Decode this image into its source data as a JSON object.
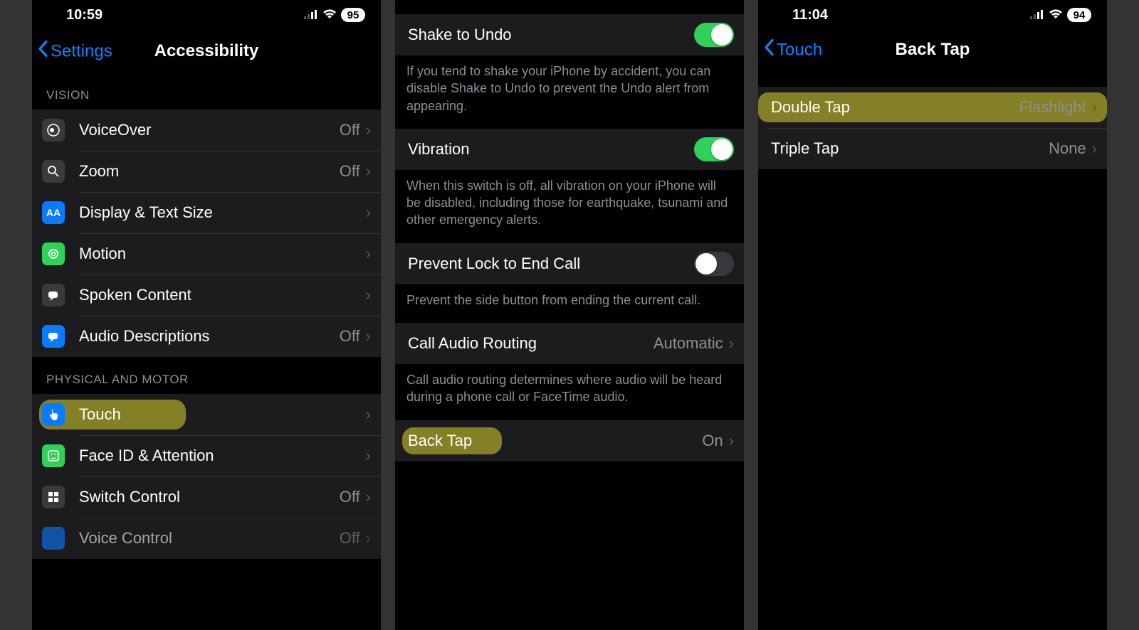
{
  "phone1": {
    "status": {
      "time": "10:59",
      "battery": "95"
    },
    "nav": {
      "back": "Settings",
      "title": "Accessibility"
    },
    "sections": {
      "vision": {
        "header": "VISION",
        "items": [
          {
            "label": "VoiceOver",
            "value": "Off"
          },
          {
            "label": "Zoom",
            "value": "Off"
          },
          {
            "label": "Display & Text Size",
            "value": ""
          },
          {
            "label": "Motion",
            "value": ""
          },
          {
            "label": "Spoken Content",
            "value": ""
          },
          {
            "label": "Audio Descriptions",
            "value": "Off"
          }
        ]
      },
      "physical": {
        "header": "PHYSICAL AND MOTOR",
        "items": [
          {
            "label": "Touch",
            "value": ""
          },
          {
            "label": "Face ID & Attention",
            "value": ""
          },
          {
            "label": "Switch Control",
            "value": "Off"
          },
          {
            "label": "Voice Control",
            "value": "Off"
          }
        ]
      }
    }
  },
  "phone2": {
    "rows": {
      "shake": {
        "label": "Shake to Undo",
        "on": true,
        "footer": "If you tend to shake your iPhone by accident, you can disable Shake to Undo to prevent the Undo alert from appearing."
      },
      "vibration": {
        "label": "Vibration",
        "on": true,
        "footer": "When this switch is off, all vibration on your iPhone will be disabled, including those for earthquake, tsunami and other emergency alerts."
      },
      "prevent": {
        "label": "Prevent Lock to End Call",
        "on": false,
        "footer": "Prevent the side button from ending the current call."
      },
      "routing": {
        "label": "Call Audio Routing",
        "value": "Automatic",
        "footer": "Call audio routing determines where audio will be heard during a phone call or FaceTime audio."
      },
      "backtap": {
        "label": "Back Tap",
        "value": "On"
      }
    }
  },
  "phone3": {
    "status": {
      "time": "11:04",
      "battery": "94"
    },
    "nav": {
      "back": "Touch",
      "title": "Back Tap"
    },
    "rows": [
      {
        "label": "Double Tap",
        "value": "Flashlight"
      },
      {
        "label": "Triple Tap",
        "value": "None"
      }
    ]
  }
}
